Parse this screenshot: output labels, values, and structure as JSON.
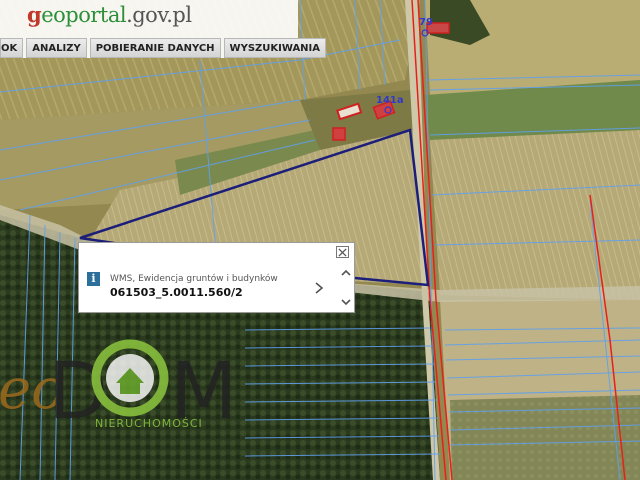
{
  "header": {
    "logo_mark": "g",
    "logo_brand": "eoportal",
    "logo_tld": ".gov.pl"
  },
  "menu": {
    "items": [
      {
        "label": "OK"
      },
      {
        "label": "ANALIZY"
      },
      {
        "label": "POBIERANIE DANYCH"
      },
      {
        "label": "WYSZUKIWANIA"
      }
    ]
  },
  "map": {
    "building_labels": [
      "79",
      "141a"
    ]
  },
  "popup": {
    "layer": "WMS, Ewidencja gruntów i budynków",
    "parcel_id": "061503_5.0011.560/2"
  },
  "watermark": {
    "text_left": "eo",
    "text_d": "D",
    "text_m": "M",
    "subtitle": "NIERUCHOMOŚCI"
  },
  "colors": {
    "parcel_lines": "#5fa0ee",
    "selected_parcel": "#1c1f7a",
    "road_line": "#e8201a",
    "watermark_green": "#8cc63f"
  }
}
